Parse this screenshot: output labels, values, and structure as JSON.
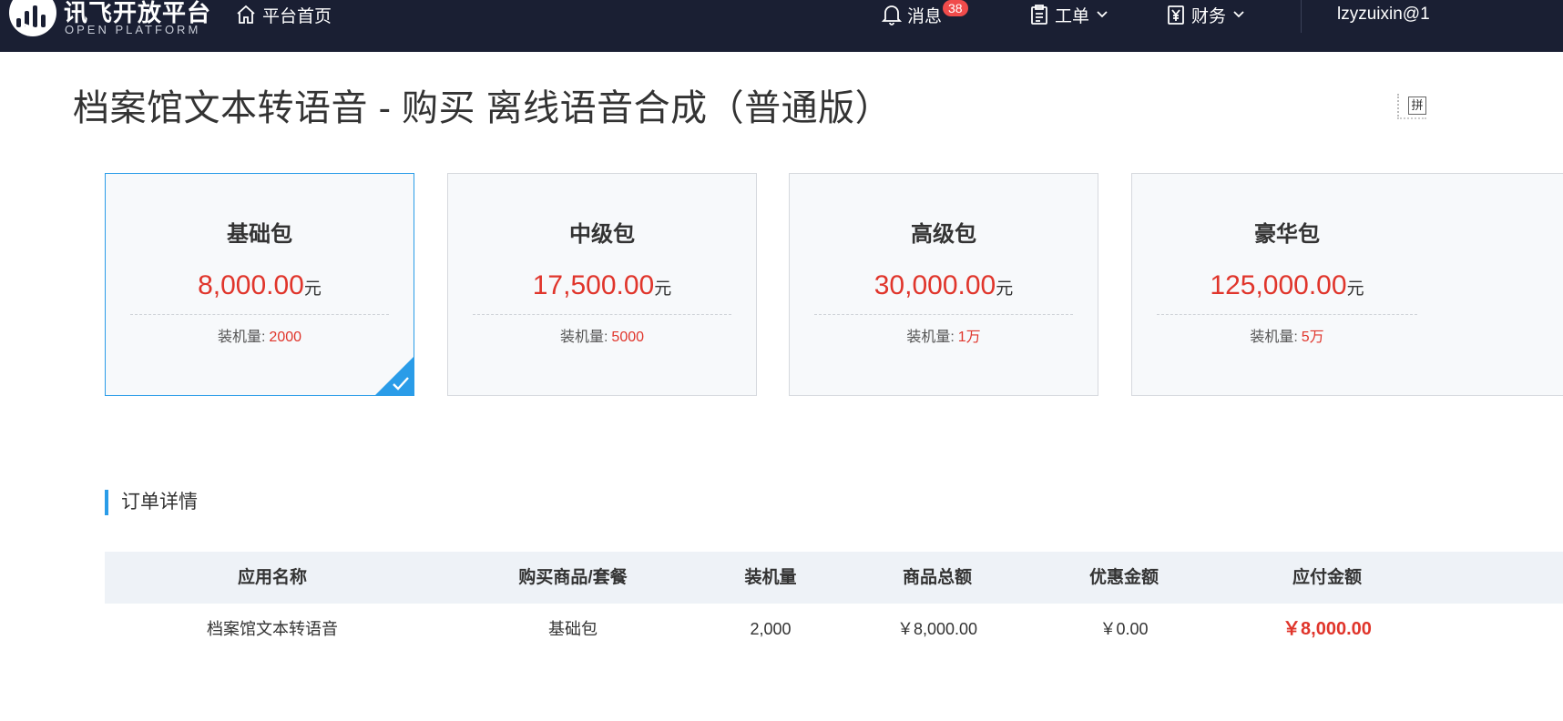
{
  "header": {
    "logo_cn": "讯飞开放平台",
    "logo_en": "OPEN PLATFORM",
    "home_label": "平台首页",
    "messages_label": "消息",
    "messages_count": "38",
    "workorder_label": "工单",
    "finance_label": "财务",
    "username": "lzyzuixin@1"
  },
  "page": {
    "title": "档案馆文本转语音 - 购买 离线语音合成（普通版）",
    "side_tool_glyph": "拼"
  },
  "packages": [
    {
      "name": "基础包",
      "price": "8,000.00",
      "unit": "元",
      "spec_label": "装机量:",
      "spec_value": "2000",
      "selected": true
    },
    {
      "name": "中级包",
      "price": "17,500.00",
      "unit": "元",
      "spec_label": "装机量:",
      "spec_value": "5000",
      "selected": false
    },
    {
      "name": "高级包",
      "price": "30,000.00",
      "unit": "元",
      "spec_label": "装机量:",
      "spec_value": "1万",
      "selected": false
    },
    {
      "name": "豪华包",
      "price": "125,000.00",
      "unit": "元",
      "spec_label": "装机量:",
      "spec_value": "5万",
      "selected": false
    }
  ],
  "order": {
    "section_title": "订单详情",
    "columns": [
      "应用名称",
      "购买商品/套餐",
      "装机量",
      "商品总额",
      "优惠金额",
      "应付金额"
    ],
    "rows": [
      [
        "档案馆文本转语音",
        "基础包",
        "2,000",
        "￥8,000.00",
        "￥0.00",
        "￥8,000.00"
      ]
    ]
  },
  "colors": {
    "topbar": "#1a1f33",
    "accent": "#2a9ce8",
    "price_red": "#e0352b",
    "badge": "#f04b4b"
  }
}
